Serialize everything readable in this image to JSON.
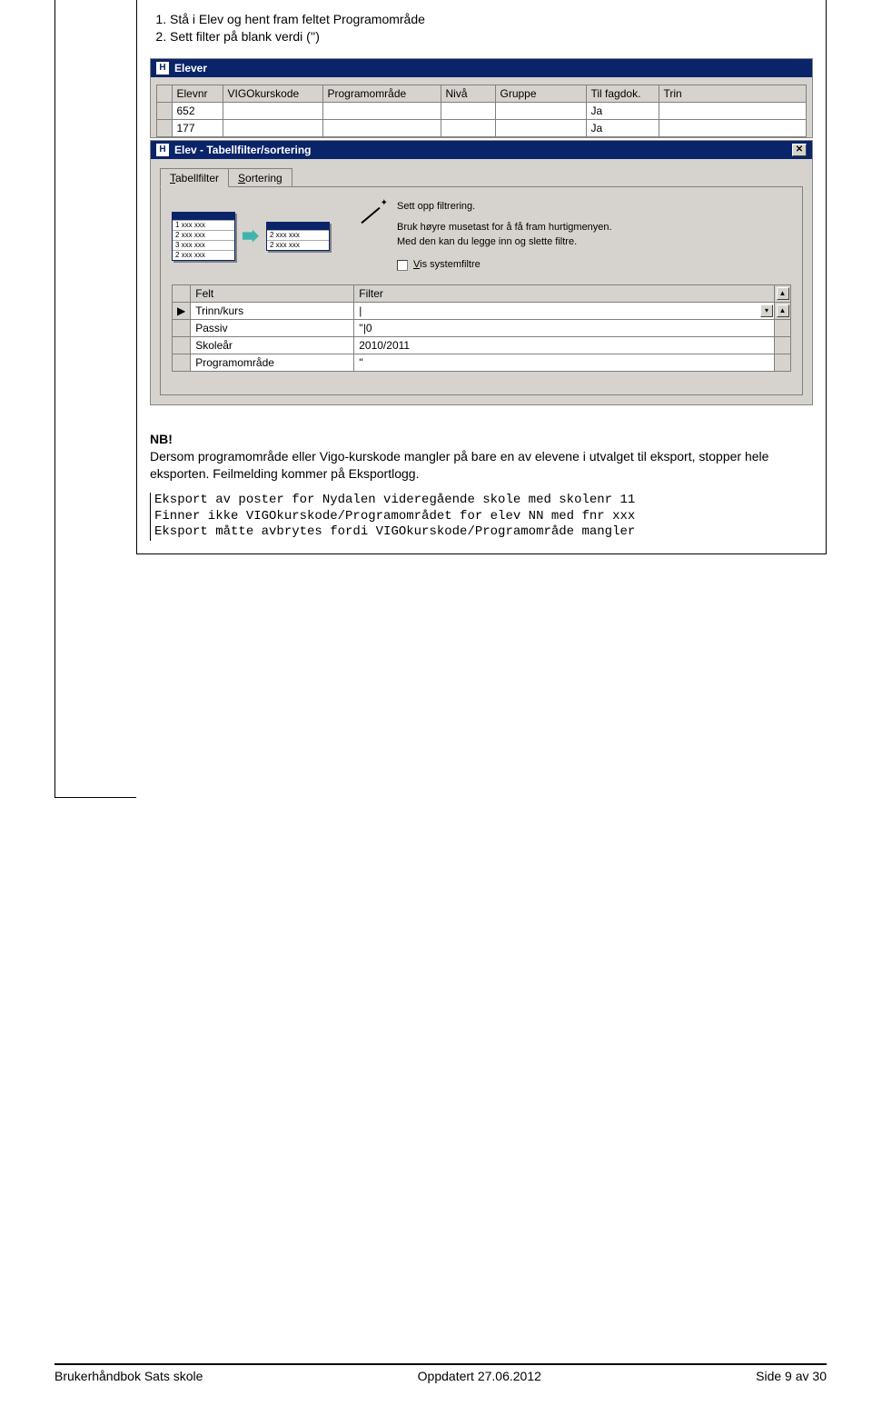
{
  "instructions": {
    "item1": "Stå i Elev og hent fram feltet Programområde",
    "item2": "Sett filter på blank verdi ('')"
  },
  "eleverWindow": {
    "title": "Elever",
    "iconLetter": "H",
    "columns": {
      "c1": "Elevnr",
      "c2": "VIGOkurskode",
      "c3": "Programområde",
      "c4": "Nivå",
      "c5": "Gruppe",
      "c6": "Til fagdok.",
      "c7": "Trin"
    },
    "rows": {
      "r1c1": "652",
      "r1c6": "Ja",
      "r2c1": "177",
      "r2c6": "Ja"
    }
  },
  "filterDialog": {
    "title": "Elev - Tabellfilter/sortering",
    "iconLetter": "H",
    "tabs": {
      "active": "Tabellfilter",
      "other": "Sortering",
      "activeUL": "T",
      "activeRest": "abellfilter",
      "otherUL": "S",
      "otherRest": "ortering"
    },
    "miniRows": {
      "a1": "1 xxx xxx",
      "a2": "2 xxx xxx",
      "a3": "3 xxx xxx",
      "a4": "2 xxx xxx",
      "b1": "2 xxx xxx",
      "b2": "2 xxx xxx"
    },
    "info": {
      "line1": "Sett opp filtrering.",
      "line2": "Bruk høyre musetast for å få fram hurtigmenyen.",
      "line3": "Med den kan du legge inn og slette filtre.",
      "checkboxUL": "V",
      "checkboxRest": "is systemfiltre"
    },
    "grid": {
      "colFelt": "Felt",
      "colFilter": "Filter",
      "r1Felt": "Trinn/kurs",
      "r1Filter": "|",
      "r2Felt": "Passiv",
      "r2Filter": "''|0",
      "r3Felt": "Skoleår",
      "r3Filter": "2010/2011",
      "r4Felt": "Programområde",
      "r4Filter": "''",
      "marker": "▶"
    }
  },
  "note": {
    "nb": "NB!",
    "text": "Dersom programområde eller Vigo-kurskode mangler på bare en av elevene i utvalget til eksport, stopper hele eksporten. Feilmelding kommer på Eksportlogg."
  },
  "mono": {
    "l1": "Eksport av poster for Nydalen videregående skole med skolenr 11",
    "l2": "Finner ikke VIGOkurskode/Programområdet for elev NN med fnr xxx",
    "l3": "Eksport måtte avbrytes fordi VIGOkurskode/Programområde mangler"
  },
  "footer": {
    "left": "Brukerhåndbok Sats skole",
    "center": "Oppdatert  27.06.2012",
    "right": "Side 9  av 30"
  }
}
